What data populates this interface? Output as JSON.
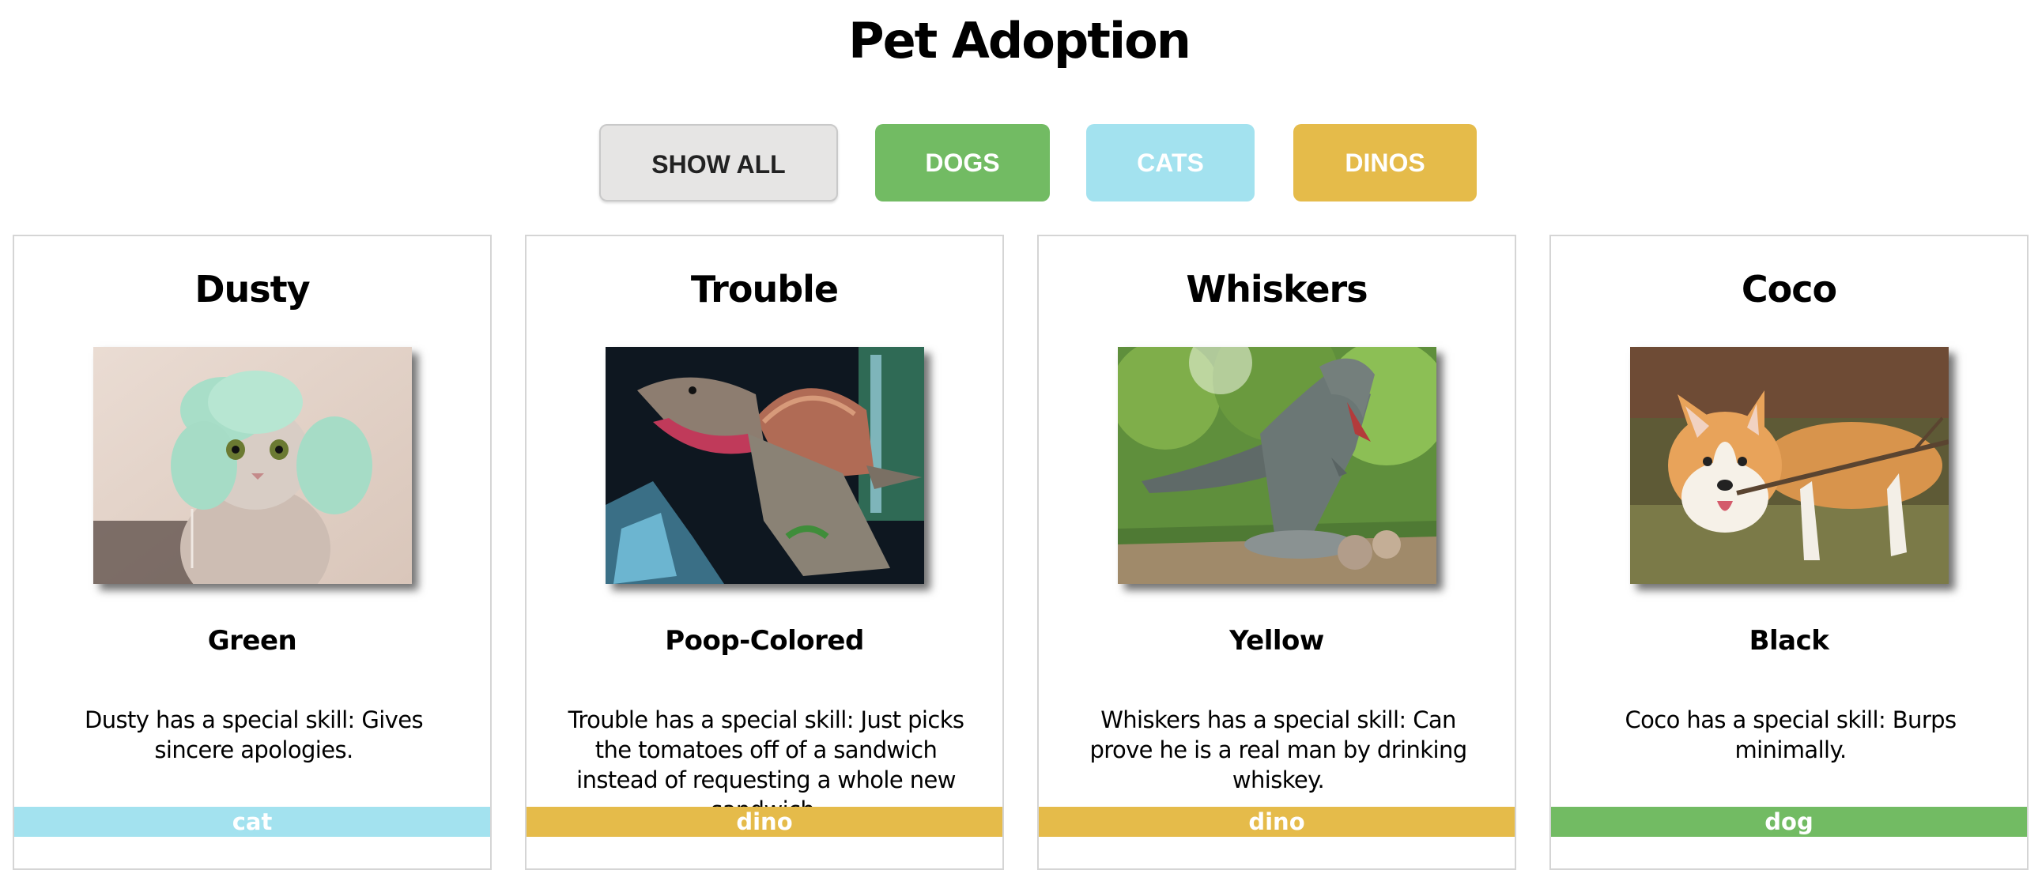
{
  "page": {
    "title": "Pet Adoption"
  },
  "filters": {
    "show_all": "SHOW ALL",
    "dogs": "DOGS",
    "cats": "CATS",
    "dinos": "DINOS"
  },
  "colors": {
    "dog": "#72bb63",
    "cat": "#a3e2ef",
    "dino": "#e5bb4a",
    "show_all": "#e6e5e4"
  },
  "pets": [
    {
      "name": "Dusty",
      "color": "Green",
      "skill": "Dusty has a special skill: Gives sincere apologies.",
      "type": "cat",
      "photo": "cat-with-towel-photo"
    },
    {
      "name": "Trouble",
      "color": "Poop-Colored",
      "skill": "Trouble has a special skill: Just picks the tomatoes off of a sandwich instead of requesting a whole new sandwich.",
      "type": "dino",
      "photo": "spinosaurus-photo"
    },
    {
      "name": "Whiskers",
      "color": "Yellow",
      "skill": "Whiskers has a special skill: Can prove he is a real man by drinking whiskey.",
      "type": "dino",
      "photo": "trex-in-forest-photo"
    },
    {
      "name": "Coco",
      "color": "Black",
      "skill": "Coco has a special skill: Burps minimally.",
      "type": "dog",
      "photo": "corgi-with-stick-photo"
    }
  ]
}
